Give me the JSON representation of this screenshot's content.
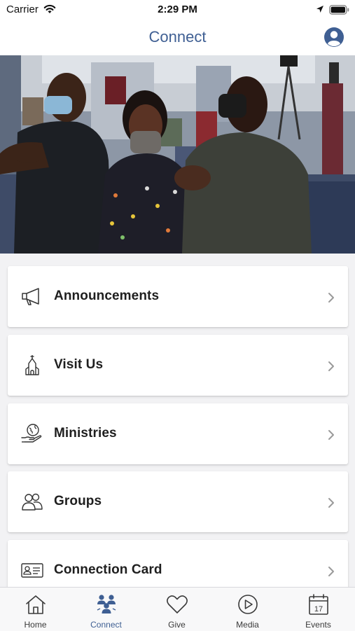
{
  "status_bar": {
    "carrier": "Carrier",
    "time": "2:29 PM"
  },
  "nav": {
    "title": "Connect"
  },
  "menu": {
    "items": [
      {
        "label": "Announcements",
        "icon": "megaphone-icon"
      },
      {
        "label": "Visit Us",
        "icon": "church-icon"
      },
      {
        "label": "Ministries",
        "icon": "globe-hand-icon"
      },
      {
        "label": "Groups",
        "icon": "people-icon"
      },
      {
        "label": "Connection Card",
        "icon": "id-card-icon"
      }
    ]
  },
  "tab_bar": {
    "items": [
      {
        "label": "Home",
        "icon": "home-icon",
        "active": false
      },
      {
        "label": "Connect",
        "icon": "people-group-icon",
        "active": true
      },
      {
        "label": "Give",
        "icon": "heart-icon",
        "active": false
      },
      {
        "label": "Media",
        "icon": "play-circle-icon",
        "active": false
      },
      {
        "label": "Events",
        "icon": "calendar-icon",
        "active": false
      }
    ],
    "calendar_day": "17"
  },
  "colors": {
    "accent": "#3f5f93",
    "background": "#f2f2f4",
    "card": "#ffffff",
    "text": "#1f1f1f"
  }
}
